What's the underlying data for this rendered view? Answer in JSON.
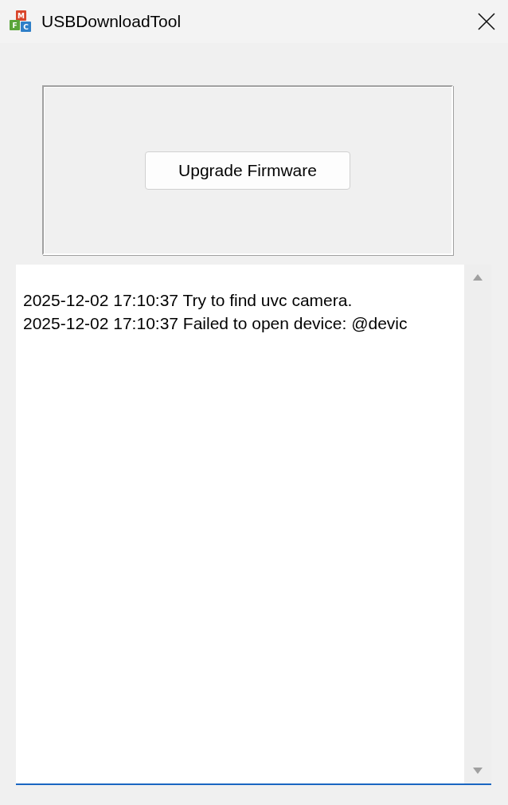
{
  "window": {
    "title": "USBDownloadTool",
    "icon_letters": [
      "M",
      "F",
      "C"
    ]
  },
  "upgrade_button": {
    "label": "Upgrade Firmware"
  },
  "log": {
    "lines": [
      "2025-12-02 17:10:37 Try to find uvc camera.",
      "2025-12-02 17:10:37 Failed to open device: @devic"
    ]
  }
}
